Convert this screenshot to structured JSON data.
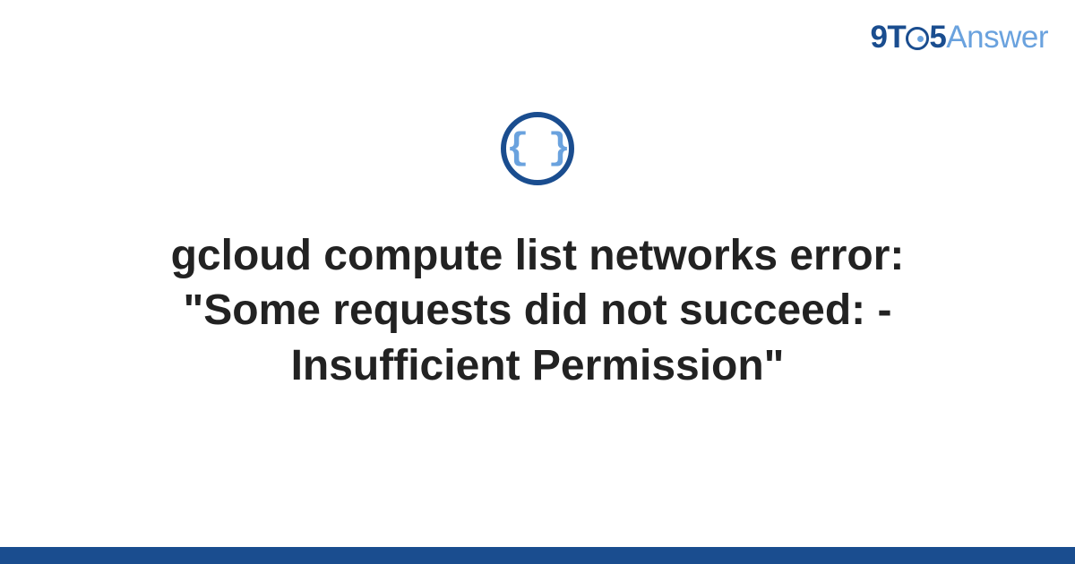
{
  "logo": {
    "nine": "9",
    "t": "T",
    "five": "5",
    "answer": "Answer"
  },
  "icon": {
    "braces": "{ }"
  },
  "title": "gcloud compute list networks error: \"Some requests did not succeed: - Insufficient Permission\""
}
